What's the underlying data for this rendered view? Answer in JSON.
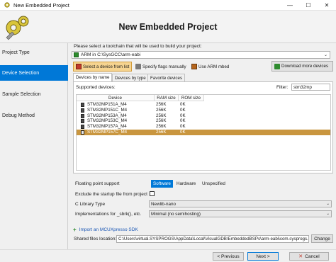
{
  "window": {
    "title": "New Embedded Project",
    "minimize": "—",
    "maximize": "☐",
    "close": "✕"
  },
  "header": {
    "heading": "New Embedded Project"
  },
  "sidebar": {
    "items": [
      {
        "label": "Project Type",
        "active": false
      },
      {
        "label": "Device Selection",
        "active": true
      },
      {
        "label": "Sample Selection",
        "active": false
      },
      {
        "label": "Debug Method",
        "active": false
      }
    ]
  },
  "toolchain": {
    "prompt": "Please select a toolchain that will be used to build your project:",
    "selected": "ARM in C:\\SysGCC\\arm-eabi"
  },
  "device_buttons": {
    "from_list": "Select a device from list",
    "specify_flags": "Specify flags manually",
    "use_mbed": "Use ARM mbed",
    "download_more": "Download more devices"
  },
  "tabs": [
    "Devices by name",
    "Devices by type",
    "Favorite devices"
  ],
  "devices": {
    "supported_label": "Supported devices:",
    "filter_label": "Filter:",
    "filter_value": "stm32mp",
    "columns": [
      "Device",
      "RAM size",
      "ROM size"
    ],
    "rows": [
      {
        "device": "STM32MP151A_M4",
        "ram": "256K",
        "rom": "0K",
        "selected": false
      },
      {
        "device": "STM32MP151C_M4",
        "ram": "256K",
        "rom": "0K",
        "selected": false
      },
      {
        "device": "STM32MP153A_M4",
        "ram": "256K",
        "rom": "0K",
        "selected": false
      },
      {
        "device": "STM32MP153C_M4",
        "ram": "256K",
        "rom": "0K",
        "selected": false
      },
      {
        "device": "STM32MP157A_M4",
        "ram": "256K",
        "rom": "0K",
        "selected": false
      },
      {
        "device": "STM32MP157C_M4",
        "ram": "256K",
        "rom": "0K",
        "selected": true
      }
    ]
  },
  "options": {
    "fp_label": "Floating point support",
    "fp_choices": [
      "Software",
      "Hardware",
      "Unspecified"
    ],
    "fp_selected": "Software",
    "exclude_startup": "Exclude the startup file from project",
    "clib_label": "C Library Type",
    "clib_value": "Newlib-nano",
    "impl_label": "Implementations for _sbrk(), etc.",
    "impl_value": "Minimal (no semihosting)",
    "import_link": "Import an MCUXpresso SDK",
    "shared_label": "Shared files location:",
    "shared_value": "C:\\Users\\virtual.SYSPROGS\\AppData\\Local\\VisualGDB\\EmbeddedBSPs\\arm-eabi\\com.sysprogs.arm.stm32",
    "change": "Change"
  },
  "footer": {
    "previous": "< Previous",
    "next": "Next >",
    "cancel": "Cancel"
  },
  "colors": {
    "accent": "#0078d7",
    "selection": "#c9963f",
    "link": "#1a56b4"
  }
}
